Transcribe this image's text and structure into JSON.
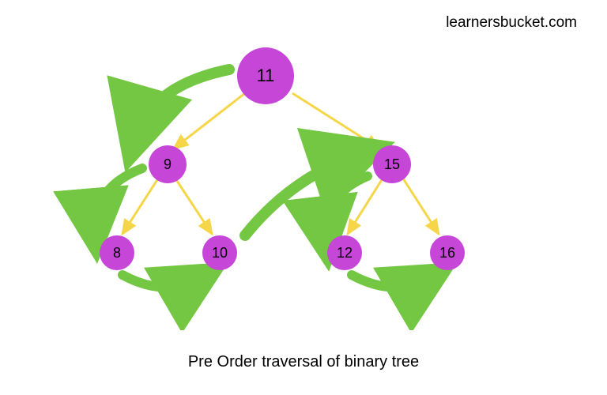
{
  "attribution": "learnersbucket.com",
  "caption": "Pre Order traversal of binary tree",
  "colors": {
    "node_fill": "#c646d8",
    "edge": "#f4d648",
    "traversal_arrow": "#74c742"
  },
  "tree": {
    "root": {
      "value": 11
    },
    "left": {
      "value": 9,
      "left": {
        "value": 8
      },
      "right": {
        "value": 10
      }
    },
    "right": {
      "value": 15,
      "left": {
        "value": 12
      },
      "right": {
        "value": 16
      }
    }
  },
  "traversal_order": [
    11,
    9,
    8,
    10,
    15,
    12,
    16
  ],
  "nodes": {
    "n11": 11,
    "n9": 9,
    "n15": 15,
    "n8": 8,
    "n10": 10,
    "n12": 12,
    "n16": 16
  }
}
